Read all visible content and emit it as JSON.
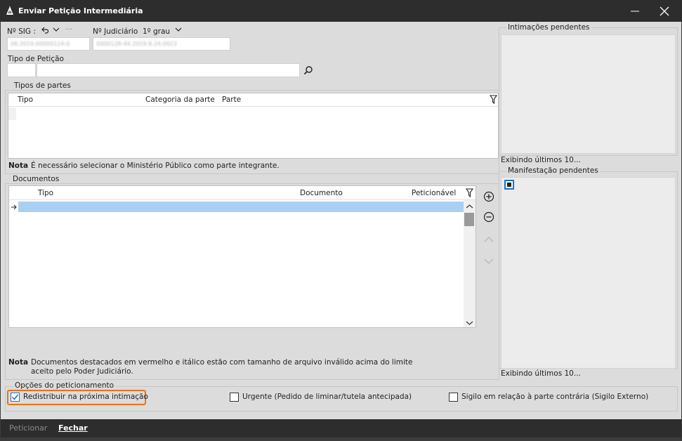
{
  "window": {
    "title": "Enviar Petição Intermediária"
  },
  "header": {
    "sig_label": "Nº SIG :",
    "sig_value": "06.2019.00000124-0",
    "judicial_label": "Nº Judiciário",
    "grau_label": "1º grau",
    "judicial_value": "0000128-44.2019.8.24.0023",
    "more_label": "···"
  },
  "tipo_peticao": {
    "label": "Tipo de Petição",
    "code": "",
    "value": ""
  },
  "tipos_partes": {
    "title": "Tipos de partes",
    "columns": [
      "Tipo",
      "Categoria da parte",
      "Parte"
    ],
    "note_label": "Nota",
    "note_text": "É necessário selecionar o Ministério Público como parte integrante."
  },
  "documentos": {
    "title": "Documentos",
    "columns": [
      "Tipo",
      "Documento",
      "Peticionável"
    ],
    "note_label": "Nota",
    "note_line1": "Documentos destacados em vermelho e itálico estão com tamanho de arquivo inválido acima do limite",
    "note_line2": "aceito pelo Poder Judiciário."
  },
  "intimacoes": {
    "title": "Intimações pendentes",
    "footer": "Exibindo últimos 10..."
  },
  "manifestacao": {
    "title": "Manifestação pendentes",
    "footer": "Exibindo últimos 10..."
  },
  "opcoes": {
    "title": "Opções do peticionamento",
    "redistribuir": {
      "label": "Redistribuir na próxima intimação",
      "checked": true
    },
    "urgente": {
      "label": "Urgente (Pedido de liminar/tutela antecipada)",
      "checked": false
    },
    "sigilo": {
      "label": "Sigilo em relação à parte contrária (Sigilo Externo)",
      "checked": false
    }
  },
  "footer": {
    "peticionar": "Peticionar",
    "fechar": "Fechar"
  },
  "colors": {
    "accent": "#1a73c9",
    "focus": "#e8731a",
    "selected_row": "#a9d0f0"
  }
}
